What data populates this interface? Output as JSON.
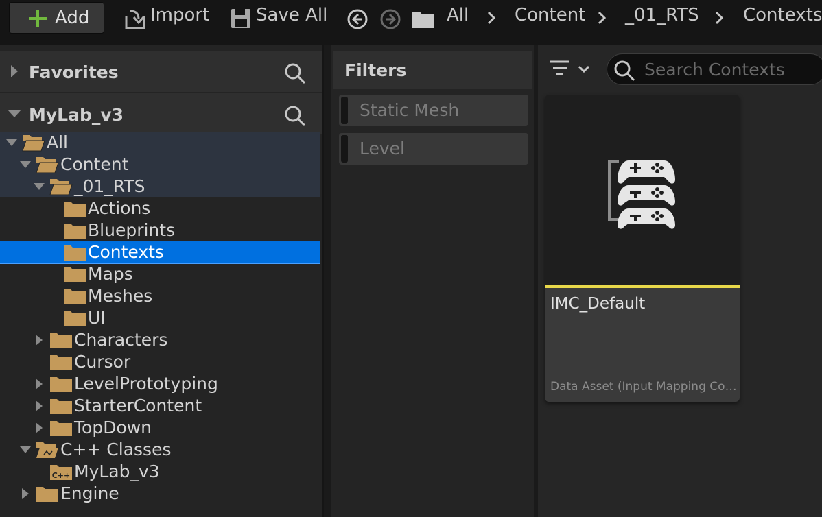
{
  "toolbar": {
    "add_label": "Add",
    "import_label": "Import",
    "save_all_label": "Save All",
    "breadcrumbs": [
      "All",
      "Content",
      "_01_RTS",
      "Contexts"
    ]
  },
  "sources": {
    "favorites_title": "Favorites",
    "project_title": "MyLab_v3",
    "tree": [
      {
        "label": "All"
      },
      {
        "label": "Content"
      },
      {
        "label": "_01_RTS"
      },
      {
        "label": "Actions"
      },
      {
        "label": "Blueprints"
      },
      {
        "label": "Contexts"
      },
      {
        "label": "Maps"
      },
      {
        "label": "Meshes"
      },
      {
        "label": "UI"
      },
      {
        "label": "Characters"
      },
      {
        "label": "Cursor"
      },
      {
        "label": "LevelPrototyping"
      },
      {
        "label": "StarterContent"
      },
      {
        "label": "TopDown"
      },
      {
        "label": "C++ Classes"
      },
      {
        "label": "MyLab_v3"
      },
      {
        "label": "Engine"
      }
    ]
  },
  "filters": {
    "title": "Filters",
    "chips": [
      "Static Mesh",
      "Level"
    ]
  },
  "content": {
    "search_placeholder": "Search Contexts",
    "assets": [
      {
        "name": "IMC_Default",
        "type": "Data Asset (Input Mapping Context)",
        "accent_color": "#e8d84a",
        "icon": "gamepad-stack-icon"
      }
    ]
  },
  "colors": {
    "selection": "#0070e0",
    "folder": "#c49a5a",
    "add_accent": "#71b93e"
  }
}
